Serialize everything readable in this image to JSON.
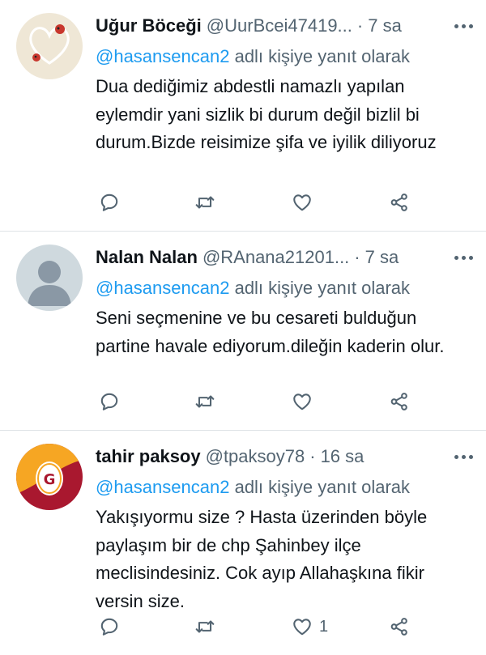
{
  "tweets": [
    {
      "name": "Uğur Böceği",
      "handle": "@UurBcei47419...",
      "separator": "·",
      "time": "7 sa",
      "reply_mention": "@hasansencan2",
      "reply_suffix": "adlı kişiye yanıt olarak",
      "text": "Dua dediğimiz abdestli namazlı yapılan eylemdir yani sizlik bi durum değil bizlil bi durum.Bizde reisimize şifa ve iyilik diliyoruz",
      "like_count": ""
    },
    {
      "name": "Nalan Nalan",
      "handle": "@RAnana21201...",
      "separator": "·",
      "time": "7 sa",
      "reply_mention": "@hasansencan2",
      "reply_suffix": "adlı kişiye yanıt olarak",
      "text": "Seni seçmenine ve bu cesareti bulduğun partine havale ediyorum.dileğin kaderin olur.",
      "like_count": ""
    },
    {
      "name": "tahir paksoy",
      "handle": "@tpaksoy78",
      "separator": "·",
      "time": "16 sa",
      "reply_mention": "@hasansencan2",
      "reply_suffix": "adlı kişiye yanıt olarak",
      "text": "Yakışıyormu size ? Hasta üzerinden böyle paylaşım bir de chp Şahinbey ilçe meclisindesiniz. Cok ayıp Allahaşkına fikir versin size.",
      "like_count": "1"
    }
  ],
  "colors": {
    "text": "#0f1419",
    "secondary": "#536471",
    "mention": "#1d9bf0",
    "divider": "#dfe3e6"
  },
  "icons": [
    "reply-icon",
    "retweet-icon",
    "like-icon",
    "share-icon",
    "more-icon"
  ]
}
